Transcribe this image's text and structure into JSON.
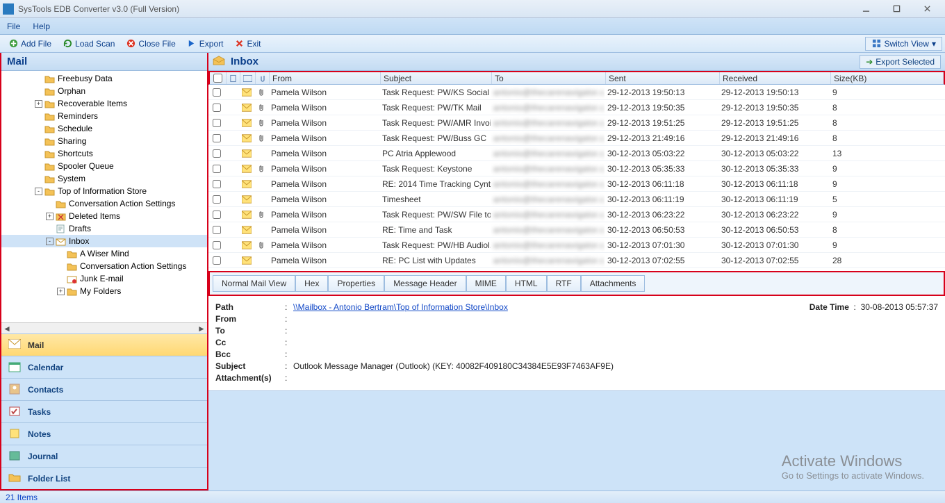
{
  "window": {
    "title": "SysTools EDB Converter v3.0 (Full Version)"
  },
  "menubar": {
    "items": [
      "File",
      "Help"
    ]
  },
  "toolbar": {
    "add_file": "Add File",
    "load_scan": "Load Scan",
    "close_file": "Close File",
    "export": "Export",
    "exit": "Exit",
    "switch_view": "Switch View"
  },
  "left_header": "Mail",
  "tree": [
    {
      "indent": 3,
      "exp": null,
      "label": "Freebusy Data",
      "icon": "folder"
    },
    {
      "indent": 3,
      "exp": null,
      "label": "Orphan",
      "icon": "folder"
    },
    {
      "indent": 3,
      "exp": "+",
      "label": "Recoverable Items",
      "icon": "folder"
    },
    {
      "indent": 3,
      "exp": null,
      "label": "Reminders",
      "icon": "folder"
    },
    {
      "indent": 3,
      "exp": null,
      "label": "Schedule",
      "icon": "folder"
    },
    {
      "indent": 3,
      "exp": null,
      "label": "Sharing",
      "icon": "folder"
    },
    {
      "indent": 3,
      "exp": null,
      "label": "Shortcuts",
      "icon": "folder"
    },
    {
      "indent": 3,
      "exp": null,
      "label": "Spooler Queue",
      "icon": "folder"
    },
    {
      "indent": 3,
      "exp": null,
      "label": "System",
      "icon": "folder"
    },
    {
      "indent": 3,
      "exp": "-",
      "label": "Top of Information Store",
      "icon": "folder"
    },
    {
      "indent": 4,
      "exp": null,
      "label": "Conversation Action Settings",
      "icon": "folder"
    },
    {
      "indent": 4,
      "exp": "+",
      "label": "Deleted Items",
      "icon": "deleted"
    },
    {
      "indent": 4,
      "exp": null,
      "label": "Drafts",
      "icon": "drafts"
    },
    {
      "indent": 4,
      "exp": "-",
      "label": "Inbox",
      "icon": "inbox",
      "selected": true
    },
    {
      "indent": 5,
      "exp": null,
      "label": "A Wiser Mind",
      "icon": "folder"
    },
    {
      "indent": 5,
      "exp": null,
      "label": "Conversation Action Settings",
      "icon": "folder"
    },
    {
      "indent": 5,
      "exp": null,
      "label": "Junk E-mail",
      "icon": "junk"
    },
    {
      "indent": 5,
      "exp": "+",
      "label": "My Folders",
      "icon": "folder"
    }
  ],
  "nav": [
    {
      "label": "Mail",
      "active": true,
      "icon": "mail"
    },
    {
      "label": "Calendar",
      "active": false,
      "icon": "calendar"
    },
    {
      "label": "Contacts",
      "active": false,
      "icon": "contacts"
    },
    {
      "label": "Tasks",
      "active": false,
      "icon": "tasks"
    },
    {
      "label": "Notes",
      "active": false,
      "icon": "notes"
    },
    {
      "label": "Journal",
      "active": false,
      "icon": "journal"
    },
    {
      "label": "Folder List",
      "active": false,
      "icon": "folderlist"
    }
  ],
  "inbox_title": "Inbox",
  "export_selected": "Export Selected",
  "columns": {
    "from": "From",
    "subject": "Subject",
    "to": "To",
    "sent": "Sent",
    "received": "Received",
    "size": "Size(KB)"
  },
  "rows": [
    {
      "clip": true,
      "from": "Pamela Wilson",
      "subject": "Task Request: PW/KS Social ...",
      "sent": "29-12-2013 19:50:13",
      "received": "29-12-2013 19:50:13",
      "size": "9"
    },
    {
      "clip": true,
      "from": "Pamela Wilson",
      "subject": "Task Request: PW/TK Mail",
      "sent": "29-12-2013 19:50:35",
      "received": "29-12-2013 19:50:35",
      "size": "8"
    },
    {
      "clip": true,
      "from": "Pamela Wilson",
      "subject": "Task Request: PW/AMR Invoi...",
      "sent": "29-12-2013 19:51:25",
      "received": "29-12-2013 19:51:25",
      "size": "8"
    },
    {
      "clip": true,
      "from": "Pamela Wilson",
      "subject": "Task Request: PW/Buss GC",
      "sent": "29-12-2013 21:49:16",
      "received": "29-12-2013 21:49:16",
      "size": "8"
    },
    {
      "clip": false,
      "from": "Pamela Wilson",
      "subject": "PC Atria Applewood",
      "sent": "30-12-2013 05:03:22",
      "received": "30-12-2013 05:03:22",
      "size": "13"
    },
    {
      "clip": true,
      "from": "Pamela Wilson",
      "subject": "Task Request: Keystone",
      "sent": "30-12-2013 05:35:33",
      "received": "30-12-2013 05:35:33",
      "size": "9"
    },
    {
      "clip": false,
      "from": "Pamela Wilson",
      "subject": "RE: 2014 Time Tracking Cynt...",
      "sent": "30-12-2013 06:11:18",
      "received": "30-12-2013 06:11:18",
      "size": "9"
    },
    {
      "clip": false,
      "from": "Pamela Wilson",
      "subject": "Timesheet",
      "sent": "30-12-2013 06:11:19",
      "received": "30-12-2013 06:11:19",
      "size": "5"
    },
    {
      "clip": true,
      "from": "Pamela Wilson",
      "subject": "Task Request: PW/SW File to...",
      "sent": "30-12-2013 06:23:22",
      "received": "30-12-2013 06:23:22",
      "size": "9"
    },
    {
      "clip": false,
      "from": "Pamela Wilson",
      "subject": "RE: Time and Task",
      "sent": "30-12-2013 06:50:53",
      "received": "30-12-2013 06:50:53",
      "size": "8"
    },
    {
      "clip": true,
      "from": "Pamela Wilson",
      "subject": "Task Request: PW/HB Audiol...",
      "sent": "30-12-2013 07:01:30",
      "received": "30-12-2013 07:01:30",
      "size": "9"
    },
    {
      "clip": false,
      "from": "Pamela Wilson",
      "subject": "RE: PC List with Updates",
      "sent": "30-12-2013 07:02:55",
      "received": "30-12-2013 07:02:55",
      "size": "28"
    }
  ],
  "to_blurred": "antonio@thecarenavigator.c...",
  "view_tabs": [
    "Normal Mail View",
    "Hex",
    "Properties",
    "Message Header",
    "MIME",
    "HTML",
    "RTF",
    "Attachments"
  ],
  "details": {
    "path_label": "Path",
    "path_prefix": "\\\\Mailbox",
    "path_rest": " - Antonio Bertram\\Top of Information Store\\Inbox",
    "datetime_label": "Date Time",
    "datetime_value": "30-08-2013 05:57:37",
    "from_label": "From",
    "to_label": "To",
    "cc_label": "Cc",
    "bcc_label": "Bcc",
    "subject_label": "Subject",
    "subject_value": "Outlook Message Manager (Outlook) (KEY: 40082F409180C34384E5E93F7463AF9E)",
    "attach_label": "Attachment(s)"
  },
  "watermark": {
    "line1": "Activate Windows",
    "line2": "Go to Settings to activate Windows."
  },
  "status": "21 Items"
}
